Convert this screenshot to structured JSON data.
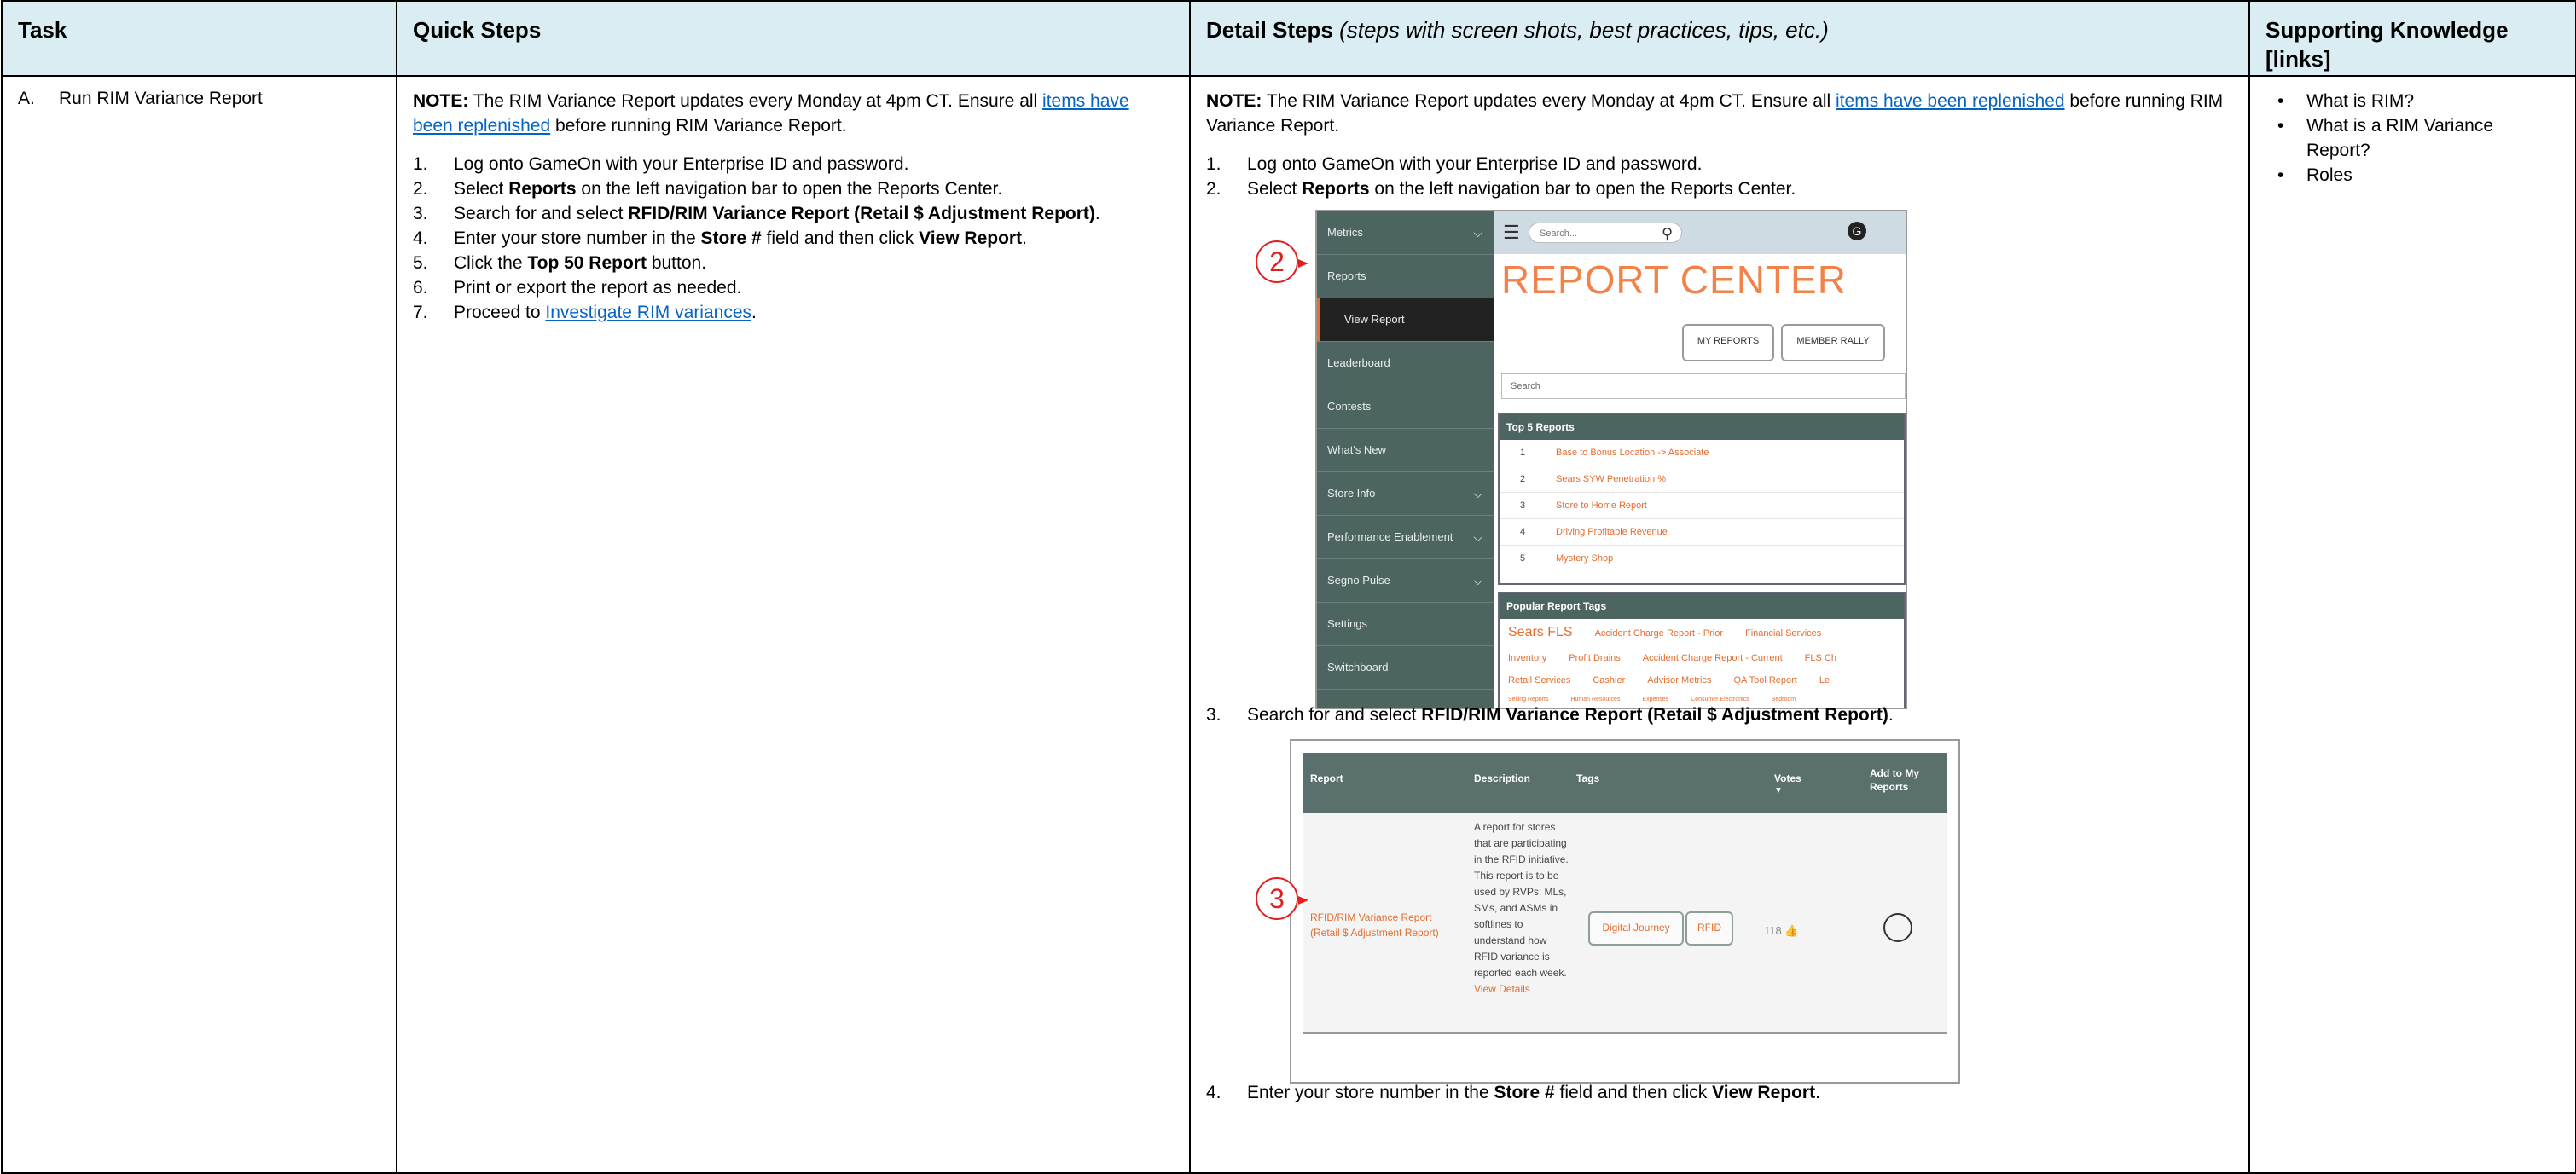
{
  "headers": {
    "task": "Task",
    "quick": "Quick Steps",
    "detail_bold": "Detail Steps",
    "detail_italic": "(steps with screen shots, best practices, tips, etc.)",
    "knowledge": "Supporting Knowledge [links]"
  },
  "task": {
    "letter": "A.",
    "label": "Run RIM Variance Report"
  },
  "quick": {
    "note_label": "NOTE:",
    "note_text": " The RIM Variance Report updates every Monday at 4pm CT. Ensure all ",
    "note_link": "items have been replenished",
    "note_tail": " before running RIM Variance Report.",
    "steps": [
      {
        "num": "1.",
        "a": "Log onto GameOn with your Enterprise ID and password.",
        "b": "",
        "c": "",
        "d": "",
        "e": ""
      },
      {
        "num": "2.",
        "a": "Select ",
        "b": "Reports",
        "c": " on the left navigation bar to open the Reports Center.",
        "d": "",
        "e": ""
      },
      {
        "num": "3.",
        "a": "Search for and select ",
        "b": "RFID/RIM Variance Report (Retail $ Adjustment Report)",
        "c": ".",
        "d": "",
        "e": ""
      },
      {
        "num": "4.",
        "a": "Enter your store number in the ",
        "b": "Store #",
        "c": " field and then click ",
        "d": "View Report",
        "e": "."
      },
      {
        "num": "5.",
        "a": "Click the ",
        "b": "Top 50 Report",
        "c": " button.",
        "d": "",
        "e": ""
      },
      {
        "num": "6.",
        "a": "Print or export the report as needed.",
        "b": "",
        "c": "",
        "d": "",
        "e": ""
      },
      {
        "num": "7.",
        "a": "Proceed to ",
        "link": "Investigate RIM variances",
        "c": "."
      }
    ]
  },
  "detail": {
    "step1": {
      "num": "1.",
      "text": "Log onto GameOn with your Enterprise ID and password."
    },
    "step2": {
      "num": "2.",
      "a": "Select ",
      "b": "Reports",
      "c": " on the left navigation bar to open the Reports Center."
    },
    "step3": {
      "num": "3.",
      "a": "Search for and select ",
      "b": "RFID/RIM Variance Report (Retail $ Adjustment Report)",
      "c": "."
    },
    "step4": {
      "num": "4.",
      "a": "Enter your store number in the ",
      "b": "Store #",
      "c": " field and then click ",
      "d": "View Report",
      "e": "."
    }
  },
  "shot1": {
    "callout": "2",
    "nav": [
      "Metrics",
      "Reports",
      "View Report",
      "Leaderboard",
      "Contests",
      "What's New",
      "Store Info",
      "Performance Enablement",
      "Segno Pulse",
      "Settings",
      "Switchboard"
    ],
    "search_placeholder": "Search...",
    "title": "REPORT CENTER",
    "btn_my": "MY REPORTS",
    "btn_rally": "MEMBER RALLY",
    "search2": "Search",
    "top5_title": "Top 5 Reports",
    "top5": [
      {
        "n": "1",
        "t": "Base to Bonus Location -> Associate"
      },
      {
        "n": "2",
        "t": "Sears SYW Penetration %"
      },
      {
        "n": "3",
        "t": "Store to Home Report"
      },
      {
        "n": "4",
        "t": "Driving Profitable Revenue"
      },
      {
        "n": "5",
        "t": "Mystery Shop"
      }
    ],
    "tags_title": "Popular Report Tags",
    "tags_row1": [
      "Sears FLS",
      "Accident Charge Report - Prior",
      "Financial Services"
    ],
    "tags_row2": [
      "Inventory",
      "Profit Drains",
      "Accident Charge Report - Current",
      "FLS Ch"
    ],
    "tags_row3": [
      "Retail Services",
      "Cashier",
      "Advisor Metrics",
      "QA Tool Report",
      "Le"
    ],
    "tags_row4": [
      "Selling Reports",
      "Human Resources",
      "Expenses",
      "Consumer Electronics",
      "Bedroom"
    ]
  },
  "shot2": {
    "callout": "3",
    "cols": {
      "report": "Report",
      "description": "Description",
      "tags": "Tags",
      "votes": "Votes",
      "add": "Add to My Reports"
    },
    "report_name": "RFID/RIM Variance Report (Retail $ Adjustment Report)",
    "description": "A report for stores that are participating in the RFID initiative. This report is to be used by RVPs, MLs, SMs, and ASMs in softlines to understand how RFID variance is reported each week.",
    "view_details": "View Details",
    "tag1": "Digital Journey",
    "tag2": "RFID",
    "votes": "118"
  },
  "knowledge": {
    "links": [
      "What is RIM?",
      "What is a RIM Variance Report?",
      "Roles"
    ]
  }
}
